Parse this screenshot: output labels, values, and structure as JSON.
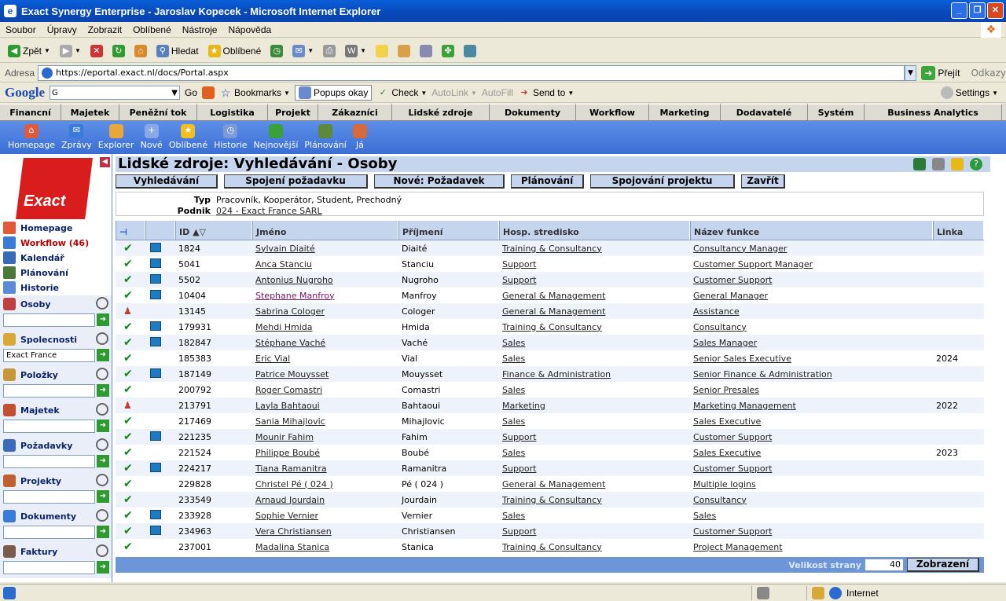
{
  "window": {
    "title": "Exact Synergy Enterprise - Jaroslav Kopecek - Microsoft Internet Explorer"
  },
  "menu": [
    "Soubor",
    "Úpravy",
    "Zobrazit",
    "Oblíbené",
    "Nástroje",
    "Nápověda"
  ],
  "toolbar": {
    "back": "Zpět",
    "search": "Hledat",
    "favorites": "Oblíbené"
  },
  "address": {
    "label": "Adresa",
    "url": "https://eportal.exact.nl/docs/Portal.aspx",
    "go": "Přejít",
    "links": "Odkazy"
  },
  "google": {
    "logo": "Google",
    "go": "Go",
    "bookmarks": "Bookmarks",
    "popups": "Popups okay",
    "check": "Check",
    "autolink": "AutoLink",
    "autofill": "AutoFill",
    "sendto": "Send to",
    "settings": "Settings"
  },
  "appnav": [
    "Financní",
    "Majetek",
    "Peněžní tok",
    "Logistika",
    "Projekt",
    "Zákazníci",
    "Lidské zdroje",
    "Dokumenty",
    "Workflow",
    "Marketing",
    "Dodavatelé",
    "Systém",
    "Business Analytics"
  ],
  "iconbar": [
    "Homepage",
    "Zprávy",
    "Explorer",
    "Nové",
    "Oblíbené",
    "Historie",
    "Nejnovější",
    "Plánování",
    "Já"
  ],
  "sidebar": {
    "logo": "Exact",
    "items": [
      "Homepage",
      "Workflow (46)",
      "Kalendář",
      "Plánování",
      "Historie"
    ],
    "sections": [
      {
        "label": "Osoby",
        "value": ""
      },
      {
        "label": "Spolecnosti",
        "value": "Exact France"
      },
      {
        "label": "Položky",
        "value": ""
      },
      {
        "label": "Majetek",
        "value": ""
      },
      {
        "label": "Požadavky",
        "value": ""
      },
      {
        "label": "Projekty",
        "value": ""
      },
      {
        "label": "Dokumenty",
        "value": ""
      },
      {
        "label": "Faktury",
        "value": ""
      }
    ]
  },
  "page": {
    "title": "Lidské zdroje: Vyhledávání - Osoby",
    "buttons": [
      "Vyhledávání",
      "Spojení požadavku",
      "Nové: Požadavek",
      "Plánování",
      "Spojování projektu",
      "Zavřít"
    ],
    "filter": {
      "type_label": "Typ",
      "type_value": "Pracovník, Kooperátor, Student, Prechodný",
      "company_label": "Podnik",
      "company_value": "024 - Exact France SARL"
    }
  },
  "grid": {
    "headers": [
      "ID",
      "Jméno",
      "Příjmení",
      "Hosp. stredisko",
      "Název funkce",
      "Linka"
    ],
    "rows": [
      {
        "icon": "check",
        "mon": true,
        "id": "1824",
        "name": "Sylvain Diaité",
        "surname": "Diaité",
        "dept": "Training & Consultancy",
        "func": "Consultancy Manager",
        "ext": ""
      },
      {
        "icon": "check",
        "mon": true,
        "id": "5041",
        "name": "Anca Stanciu",
        "surname": "Stanciu",
        "dept": "Support",
        "func": "Customer Support Manager",
        "ext": ""
      },
      {
        "icon": "check",
        "mon": true,
        "id": "5502",
        "name": "Antonius Nugroho",
        "surname": "Nugroho",
        "dept": "Support",
        "func": "Customer Support",
        "ext": ""
      },
      {
        "icon": "check",
        "mon": true,
        "id": "10404",
        "name": "Stephane Manfroy",
        "surname": "Manfroy",
        "dept": "General & Management",
        "func": "General Manager",
        "ext": "",
        "visited": true
      },
      {
        "icon": "person",
        "mon": false,
        "id": "13145",
        "name": "Sabrina Cologer",
        "surname": "Cologer",
        "dept": "General & Management",
        "func": "Assistance",
        "ext": ""
      },
      {
        "icon": "check",
        "mon": true,
        "id": "179931",
        "name": "Mehdi Hmida",
        "surname": "Hmida",
        "dept": "Training & Consultancy",
        "func": "Consultancy",
        "ext": ""
      },
      {
        "icon": "check",
        "mon": true,
        "id": "182847",
        "name": "Stéphane Vaché",
        "surname": "Vaché",
        "dept": "Sales",
        "func": "Sales Manager",
        "ext": ""
      },
      {
        "icon": "check",
        "mon": false,
        "id": "185383",
        "name": "Eric Vial",
        "surname": "Vial",
        "dept": "Sales",
        "func": "Senior Sales Executive",
        "ext": "2024"
      },
      {
        "icon": "check",
        "mon": true,
        "id": "187149",
        "name": "Patrice Mouysset",
        "surname": "Mouysset",
        "dept": "Finance & Administration",
        "func": "Senior Finance & Administration",
        "ext": ""
      },
      {
        "icon": "check",
        "mon": false,
        "id": "200792",
        "name": "Roger Comastri",
        "surname": "Comastri",
        "dept": "Sales",
        "func": "Senior Presales",
        "ext": ""
      },
      {
        "icon": "person",
        "mon": false,
        "id": "213791",
        "name": "Layla Bahtaoui",
        "surname": "Bahtaoui",
        "dept": "Marketing",
        "func": "Marketing Management",
        "ext": "2022"
      },
      {
        "icon": "check",
        "mon": false,
        "id": "217469",
        "name": "Sania Mihajlovic",
        "surname": "Mihajlovic",
        "dept": "Sales",
        "func": "Sales Executive",
        "ext": ""
      },
      {
        "icon": "check",
        "mon": true,
        "id": "221235",
        "name": "Mounir Fahim",
        "surname": "Fahim",
        "dept": "Support",
        "func": "Customer Support",
        "ext": ""
      },
      {
        "icon": "check",
        "mon": false,
        "id": "221524",
        "name": "Philippe Boubé",
        "surname": "Boubé",
        "dept": "Sales",
        "func": "Sales Executive",
        "ext": "2023"
      },
      {
        "icon": "check",
        "mon": true,
        "id": "224217",
        "name": "Tiana Ramanitra",
        "surname": "Ramanitra",
        "dept": "Support",
        "func": "Customer Support",
        "ext": ""
      },
      {
        "icon": "check",
        "mon": false,
        "id": "229828",
        "name": "Christel Pé ( 024 )",
        "surname": "Pé ( 024 )",
        "dept": "General & Management",
        "func": "Multiple logins",
        "ext": ""
      },
      {
        "icon": "check",
        "mon": false,
        "id": "233549",
        "name": "Arnaud Jourdain",
        "surname": "Jourdain",
        "dept": "Training & Consultancy",
        "func": "Consultancy",
        "ext": ""
      },
      {
        "icon": "check",
        "mon": true,
        "id": "233928",
        "name": "Sophie Vernier",
        "surname": "Vernier",
        "dept": "Sales",
        "func": "Sales",
        "ext": ""
      },
      {
        "icon": "check",
        "mon": true,
        "id": "234963",
        "name": "Vera Christiansen",
        "surname": "Christiansen",
        "dept": "Support",
        "func": "Customer Support",
        "ext": ""
      },
      {
        "icon": "check",
        "mon": false,
        "id": "237001",
        "name": "Madalina Stanica",
        "surname": "Stanica",
        "dept": "Training & Consultancy",
        "func": "Project Management",
        "ext": ""
      }
    ],
    "footer": {
      "page_size_label": "Velikost strany",
      "page_size": "40",
      "show_button": "Zobrazení"
    }
  },
  "status": {
    "zone": "Internet"
  }
}
